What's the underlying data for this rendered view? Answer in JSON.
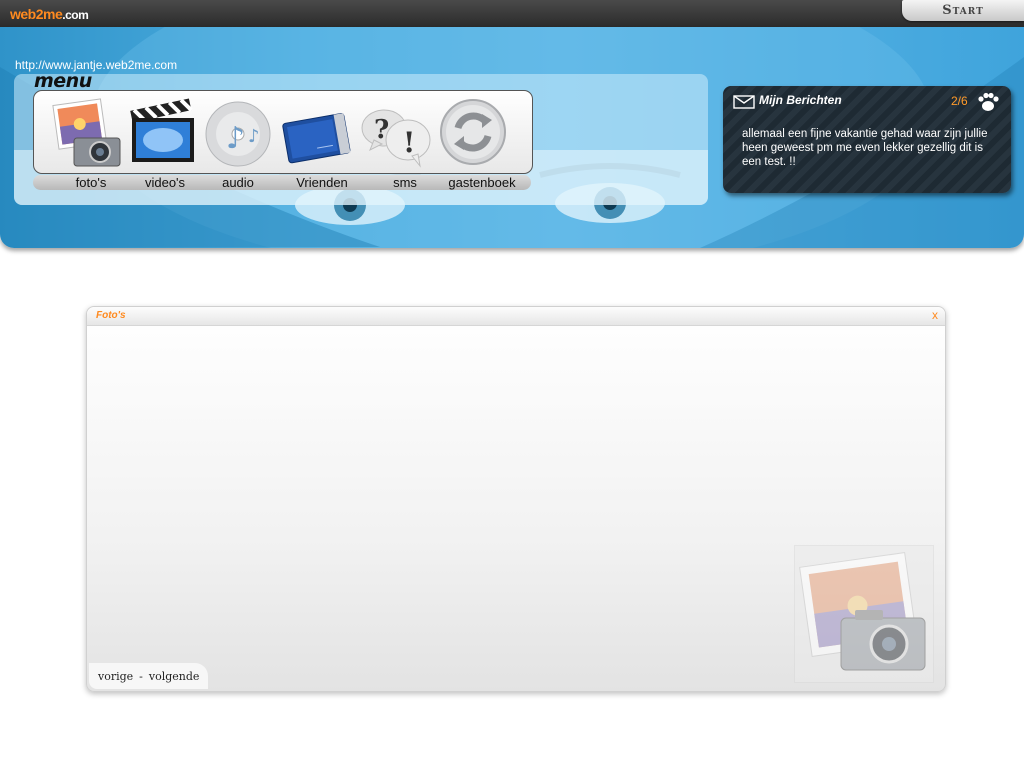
{
  "topbar": {
    "logo_main": "web2me",
    "logo_suffix": "com",
    "start_label": "Start"
  },
  "header": {
    "url": "http://www.jantje.web2me.com",
    "menu_title": "menu"
  },
  "menu": {
    "items": [
      {
        "label": "foto's",
        "icon": "photo-camera-icon"
      },
      {
        "label": "video's",
        "icon": "clapperboard-icon"
      },
      {
        "label": "audio",
        "icon": "music-disc-icon"
      },
      {
        "label": "Vrienden",
        "icon": "address-book-icon"
      },
      {
        "label": "sms",
        "icon": "question-exclamation-icon"
      },
      {
        "label": "gastenboek",
        "icon": "refresh-icon"
      }
    ]
  },
  "messages": {
    "title": "Mijn Berichten",
    "count": "2/6",
    "text": "allemaal een fijne vakantie gehad waar zijn jullie heen geweest pm me even lekker gezellig  dit is een test. !!"
  },
  "window": {
    "title": "Foto's",
    "close_label": "x",
    "prev_label": "vorige",
    "separator": "-",
    "next_label": "volgende"
  },
  "colors": {
    "accent": "#ff8a1f",
    "banner_blue": "#4eaee0",
    "topbar": "#2b2b2b"
  }
}
